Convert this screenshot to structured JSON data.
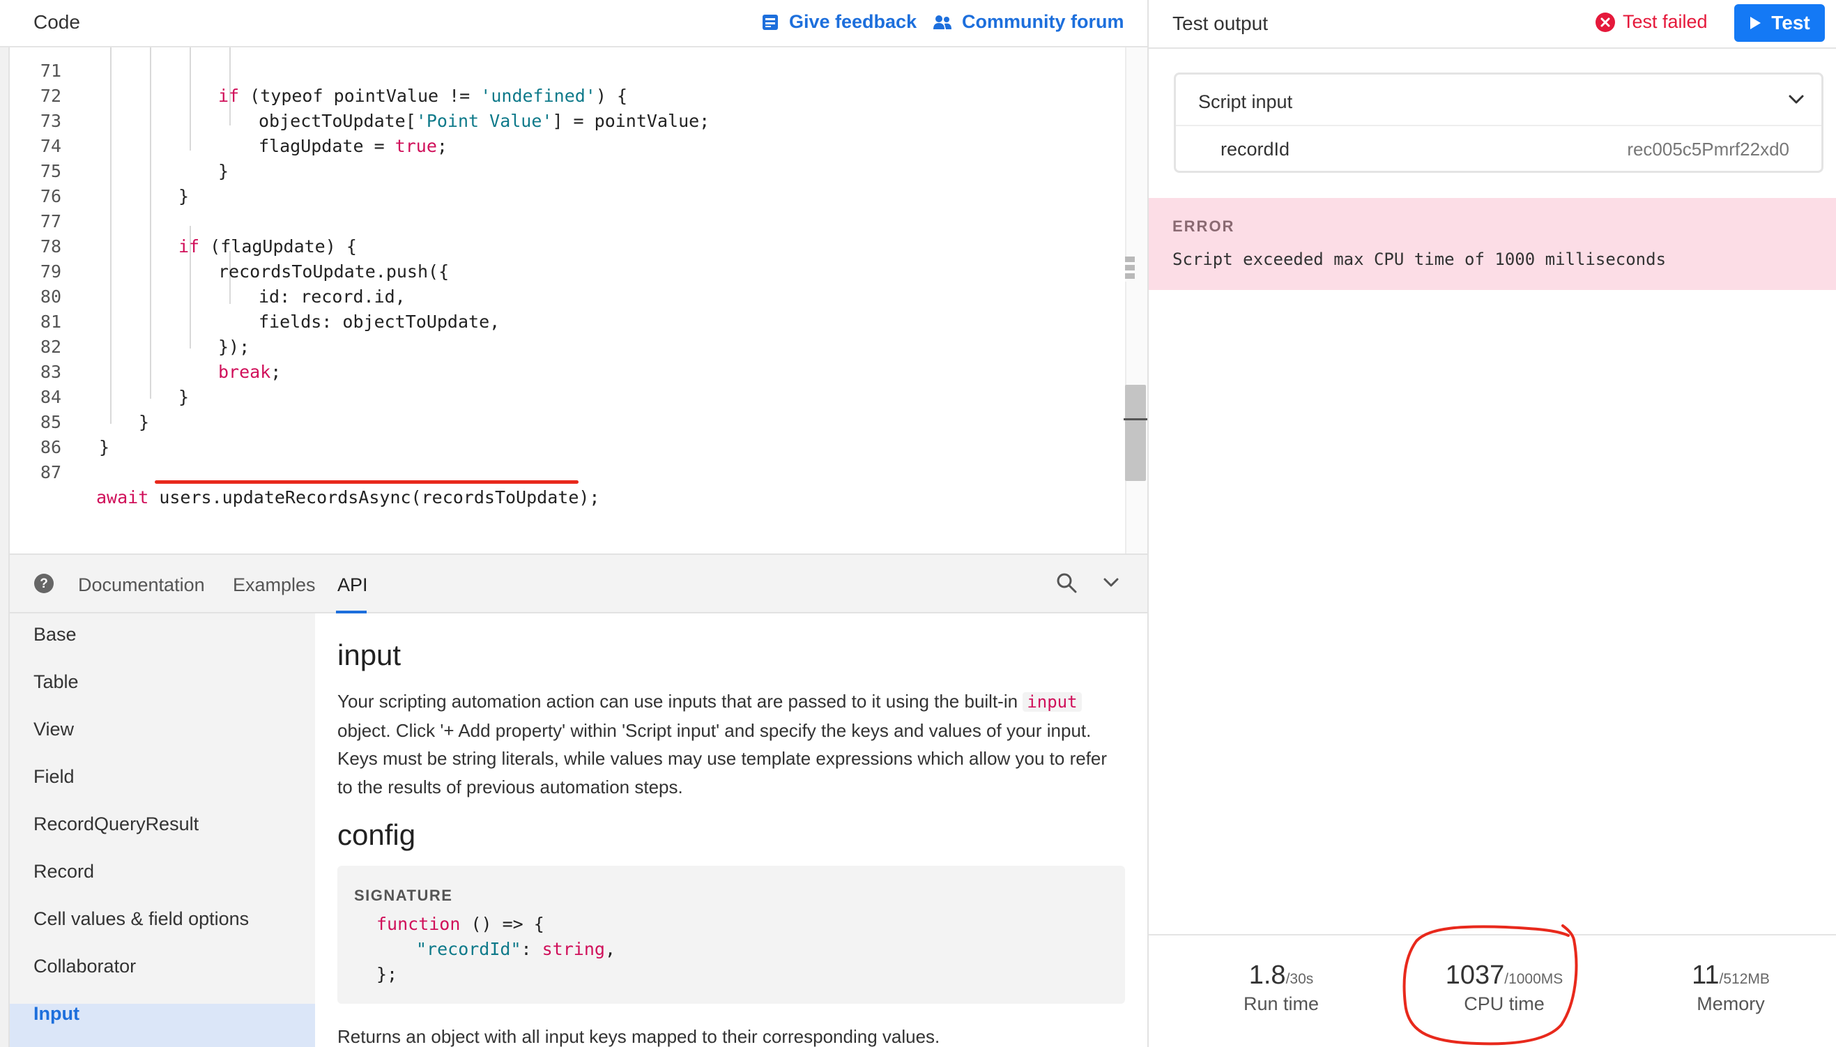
{
  "code_panel": {
    "title": "Code",
    "feedback_link": "Give feedback",
    "forum_link": "Community forum",
    "lines": [
      {
        "num": "71",
        "text": "if (typeof pointValue != 'undefined') {"
      },
      {
        "num": "72",
        "text": "objectToUpdate['Point Value'] = pointValue;"
      },
      {
        "num": "73",
        "text": "flagUpdate = true;"
      },
      {
        "num": "74",
        "text": "}"
      },
      {
        "num": "75",
        "text": "}"
      },
      {
        "num": "76",
        "text": ""
      },
      {
        "num": "77",
        "text": "if (flagUpdate) {"
      },
      {
        "num": "78",
        "text": "recordsToUpdate.push({"
      },
      {
        "num": "79",
        "text": "id: record.id,"
      },
      {
        "num": "80",
        "text": "fields: objectToUpdate,"
      },
      {
        "num": "81",
        "text": "});"
      },
      {
        "num": "82",
        "text": "break;"
      },
      {
        "num": "83",
        "text": "}"
      },
      {
        "num": "84",
        "text": "}"
      },
      {
        "num": "85",
        "text": "}"
      },
      {
        "num": "86",
        "text": ""
      },
      {
        "num": "87",
        "text": "await users.updateRecordsAsync(recordsToUpdate);"
      }
    ],
    "tokens": {
      "l71_kw": "if",
      "l71_mid": " (typeof pointValue != ",
      "l71_str": "'undefined'",
      "l71_end": ") {",
      "l72_a": "objectToUpdate[",
      "l72_str": "'Point Value'",
      "l72_b": "] = pointValue;",
      "l73_a": "flagUpdate = ",
      "l73_kw": "true",
      "l73_b": ";",
      "brace": "}",
      "l77_kw": "if",
      "l77_b": " (flagUpdate) {",
      "l78": "recordsToUpdate.push({",
      "l79": "id: record.id,",
      "l80": "fields: objectToUpdate,",
      "l81": "});",
      "l82_kw": "break",
      "l82_b": ";",
      "l87_kw": "await",
      "l87_b": " users.updateRecordsAsync(recordsToUpdate);"
    }
  },
  "docs": {
    "tabs": [
      "Documentation",
      "Examples",
      "API"
    ],
    "active_tab": "API",
    "sidebar": [
      "Base",
      "Table",
      "View",
      "Field",
      "RecordQueryResult",
      "Record",
      "Cell values & field options",
      "Collaborator",
      "Input"
    ],
    "active_item": "Input",
    "heading_input": "input",
    "para_before": "Your scripting automation action can use inputs that are passed to it using the built-in ",
    "para_code": "input",
    "para_after": " object. Click '+ Add property' within 'Script input' and specify the keys and values of your input. Keys must be string literals, while values may use template expressions which allow you to refer to the results of previous automation steps.",
    "heading_config": "config",
    "signature_label": "SIGNATURE",
    "sig_kw": "function",
    "sig_a": " () => {",
    "sig_str": "\"recordId\"",
    "sig_colon": ": ",
    "sig_type": "string",
    "sig_comma": ",",
    "sig_close": "};",
    "returns": "Returns an object with all input keys mapped to their corresponding values."
  },
  "output": {
    "title": "Test output",
    "status": "Test failed",
    "test_button": "Test",
    "script_input_title": "Script input",
    "input_key": "recordId",
    "input_value": "rec005c5Pmrf22xd0",
    "error_label": "ERROR",
    "error_message": "Script exceeded max CPU time of 1000 milliseconds",
    "stats": [
      {
        "value": "1.8",
        "limit": "/30s",
        "label": "Run time"
      },
      {
        "value": "1037",
        "limit": "/1000MS",
        "label": "CPU time"
      },
      {
        "value": "11",
        "limit": "/512MB",
        "label": "Memory"
      }
    ]
  },
  "colors": {
    "accent": "#1d6fdc",
    "button": "#1479f5",
    "error_bg": "#fcdde6",
    "failed": "#e5193b",
    "annotation": "#e8291c",
    "keyword": "#d0105a",
    "string": "#0f7a8a"
  },
  "icons": [
    "feedback-icon",
    "community-icon",
    "help-icon",
    "search-icon",
    "chevron-down-icon",
    "error-x-icon",
    "play-icon"
  ]
}
